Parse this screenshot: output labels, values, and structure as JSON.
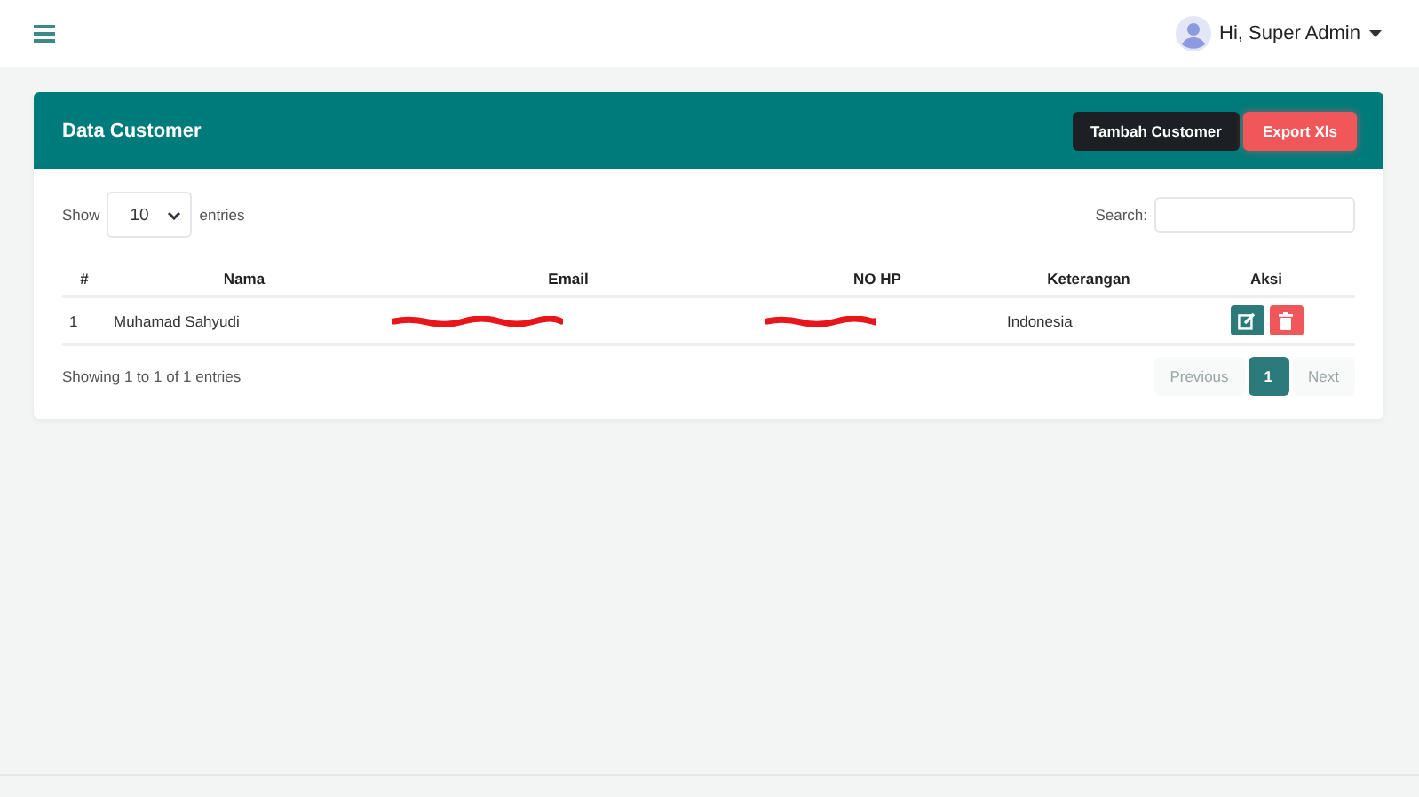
{
  "topbar": {
    "user_label": "Hi, Super Admin"
  },
  "card": {
    "title": "Data Customer",
    "buttons": [
      {
        "label": "Tambah Customer",
        "kind": "dark"
      },
      {
        "label": "Export Xls",
        "kind": "danger"
      }
    ]
  },
  "length": {
    "before": "Show",
    "value": "10",
    "after": "entries"
  },
  "search": {
    "label": "Search:"
  },
  "table": {
    "columns": [
      "#",
      "Nama",
      "Email",
      "NO HP",
      "Keterangan",
      "Aksi"
    ],
    "rows": [
      {
        "cells": [
          {
            "kind": "text",
            "text": "1"
          },
          {
            "kind": "text",
            "text": "Muhamad Sahyudi"
          },
          {
            "kind": "redacted"
          },
          {
            "kind": "redacted"
          },
          {
            "kind": "text",
            "text": "Indonesia"
          },
          {
            "kind": "actions"
          }
        ]
      }
    ]
  },
  "info": "Showing 1 to 1 of 1 entries",
  "pagination": [
    {
      "label": "Previous",
      "disabled": true,
      "selected": false
    },
    {
      "label": "1",
      "disabled": false,
      "selected": true
    },
    {
      "label": "Next",
      "disabled": true,
      "selected": false
    }
  ]
}
